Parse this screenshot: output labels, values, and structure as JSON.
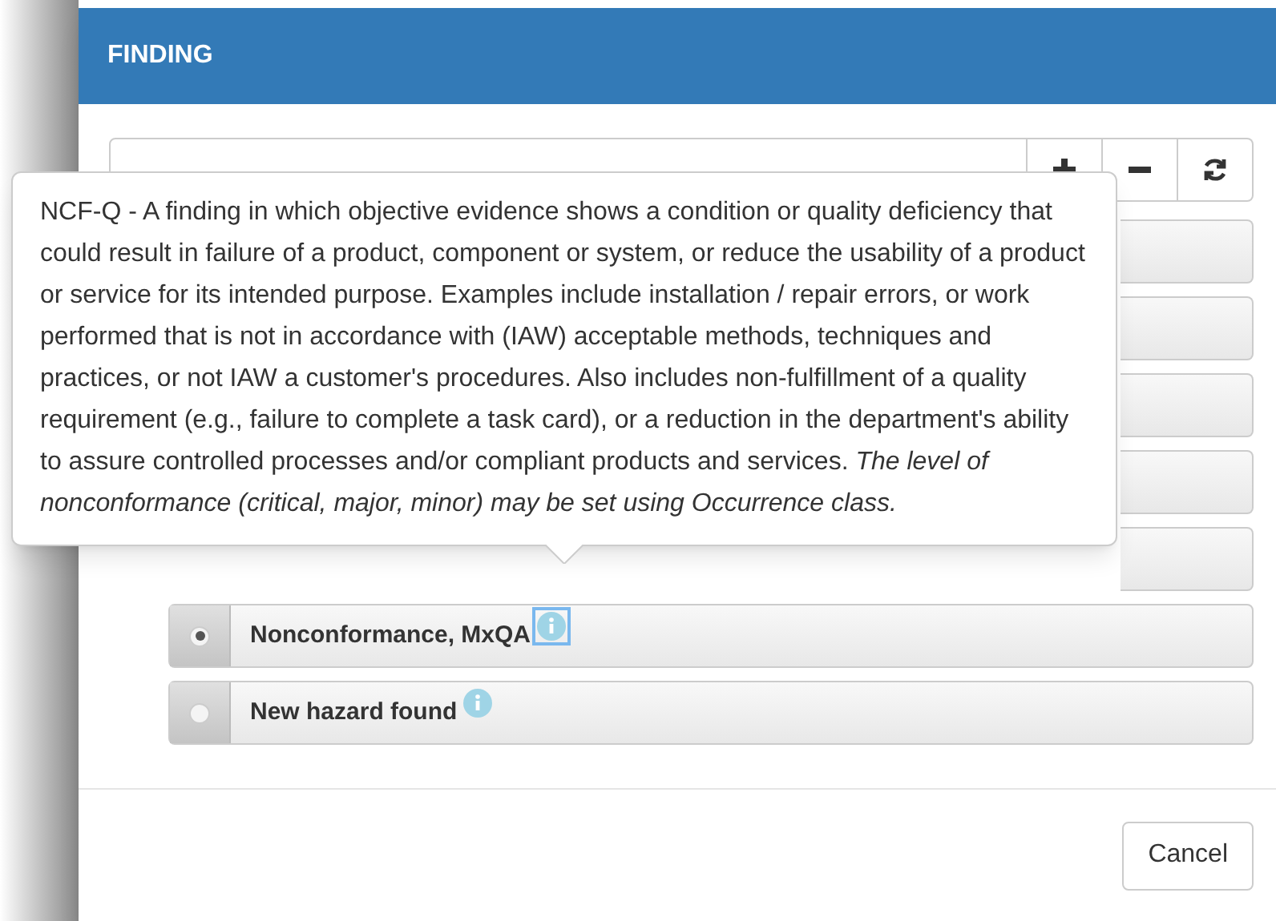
{
  "dialog": {
    "title": "FINDING"
  },
  "toolbar": [
    {
      "kind": "expand"
    },
    {
      "kind": "collapse"
    },
    {
      "kind": "refresh"
    }
  ],
  "tooltip": {
    "text": "NCF-Q - A finding in which objective evidence shows a condition or quality deficiency that could result in failure of a product, component or system, or reduce the usability of a product or service for its intended purpose. Examples include installation / repair errors, or work performed that is not in accordance with (IAW) acceptable methods, techniques and practices, or not IAW a customer's procedures. Also includes non-fulfillment of a quality requirement (e.g., failure to complete a task card), or a reduction in the department's ability to assure controlled processes and/or compliant products and services. *The level of nonconformance (critical, major, minor) may be set using Occurrence class.*"
  },
  "options": [
    {
      "label": "Nonconformance, MxQA",
      "selected": true,
      "focused": true
    },
    {
      "label": "New hazard found",
      "selected": false,
      "focused": false
    }
  ],
  "buttons": [
    "Cancel"
  ]
}
